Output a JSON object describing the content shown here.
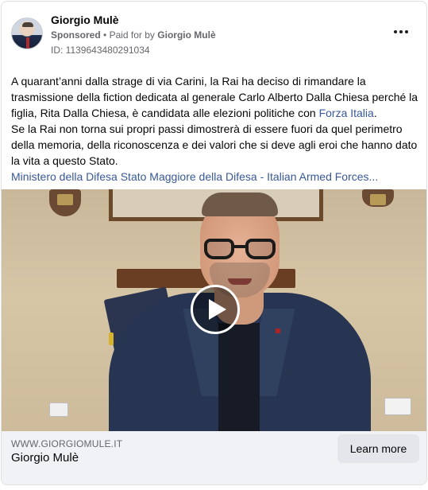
{
  "ad": {
    "page_name": "Giorgio Mulè",
    "sponsored_label": "Sponsored",
    "separator": "•",
    "paid_for_prefix": "Paid for by",
    "paid_for_name": "Giorgio Mulè",
    "ad_id": "ID: 1139643480291034"
  },
  "body": {
    "para1_a": "A quarant’anni dalla strage di via Carini, la Rai ha deciso di rimandare la trasmissione della fiction dedicata al generale Carlo Alberto Dalla Chiesa perché la figlia, Rita Dalla Chiesa, è candidata alle elezioni politiche con ",
    "para1_link": "Forza Italia",
    "para1_b": ".",
    "para2": "Se la Rai non torna sui propri passi dimostrerà di essere fuori da quel perimetro della memoria, della riconoscenza e dei valori che si deve agli eroi che hanno dato la vita a questo Stato.",
    "tags": "Ministero della Difesa Stato Maggiore della Difesa - Italian Armed Forces..."
  },
  "footer": {
    "domain": "WWW.GIORGIOMULE.IT",
    "headline": "Giorgio Mulè",
    "cta_label": "Learn more"
  }
}
